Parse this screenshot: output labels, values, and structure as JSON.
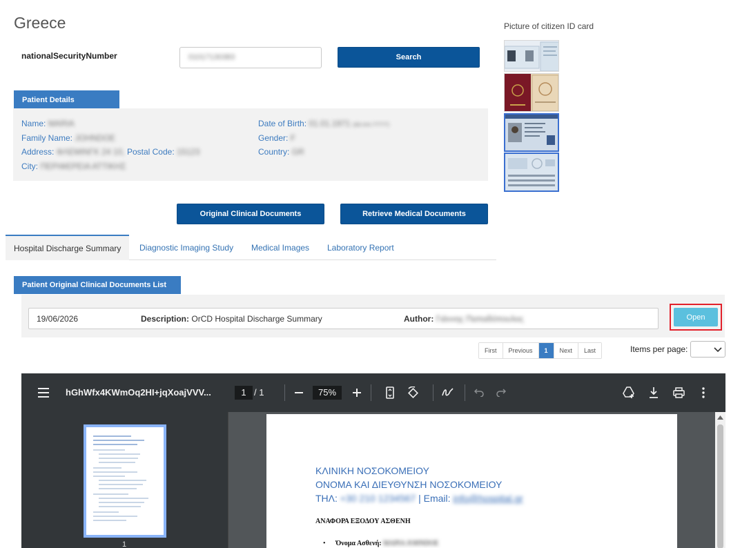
{
  "header": {
    "title": "Greece"
  },
  "search": {
    "label": "nationalSecurityNumber",
    "value": "01017130383",
    "button": "Search"
  },
  "id_card": {
    "label": "Picture of citizen ID card"
  },
  "patient_details": {
    "tab": "Patient Details",
    "name_label": "Name:",
    "name_value": "MARIA",
    "family_label": "Family Name:",
    "family_value": "JOHNDOE",
    "address_label": "Address:",
    "address_value": "ΦΛΕΜΙΝΓΚ 24 10,",
    "postal_label": "Postal Code:",
    "postal_value": "15123",
    "city_label": "City:",
    "city_value": "ΠΕΡΙΦΕΡΕΙΑ ΑΤΤΙΚΗΣ",
    "dob_label": "Date of Birth:",
    "dob_value": "01.01.1971",
    "dob_extra": "(dd.mm.YYYY)",
    "gender_label": "Gender:",
    "gender_value": "F",
    "country_label": "Country:",
    "country_value": "GR"
  },
  "actions": {
    "original_docs": "Original Clinical Documents",
    "retrieve_docs": "Retrieve Medical Documents"
  },
  "tabs": [
    {
      "label": "Hospital Discharge Summary",
      "active": true
    },
    {
      "label": "Diagnostic Imaging Study"
    },
    {
      "label": "Medical Images"
    },
    {
      "label": "Laboratory Report"
    }
  ],
  "documents": {
    "tab": "Patient Original Clinical Documents List",
    "rows": [
      {
        "date": "19/06/2026",
        "desc_label": "Description:",
        "desc": "OrCD Hospital Discharge Summary",
        "author_label": "Author:",
        "author": "Γιάννης Παπαδόπουλος",
        "open": "Open"
      }
    ]
  },
  "pagination": {
    "first": "First",
    "previous": "Previous",
    "current": "1",
    "next": "Next",
    "last": "Last",
    "items_per_page": "Items per page:"
  },
  "pdf_viewer": {
    "filename": "hGhWfx4KWmOq2HI+jqXoajVVV...",
    "page": "1",
    "total": "/ 1",
    "zoom": "75%",
    "thumb_number": "1",
    "content": {
      "line1": "ΚΛΙΝΙΚΗ ΝΟΣΟΚΟΜΕΙΟΥ",
      "line2": "ΟΝΟΜΑ ΚΑΙ ΔΙΕΥΘΥΝΣΗ ΝΟΣΟΚΟΜΕΙΟΥ",
      "phone_label": "ΤΗΛ:",
      "phone": "+30 210 1234567",
      "email_label": "| Email:",
      "email": "info@hospital.gr",
      "report_title": "ΑΝΑΦΟΡΑ ΕΞΟΔΟΥ ΑΣΘΕΝΗ",
      "patient_label": "Όνομα Ασθενή:",
      "patient_value": "ΜΑΡΙΑ JOHNDOE"
    }
  },
  "colors": {
    "primary": "#0b5599",
    "tab": "#3a7cc2",
    "open": "#5bc0de",
    "highlight": "#e2202a"
  }
}
